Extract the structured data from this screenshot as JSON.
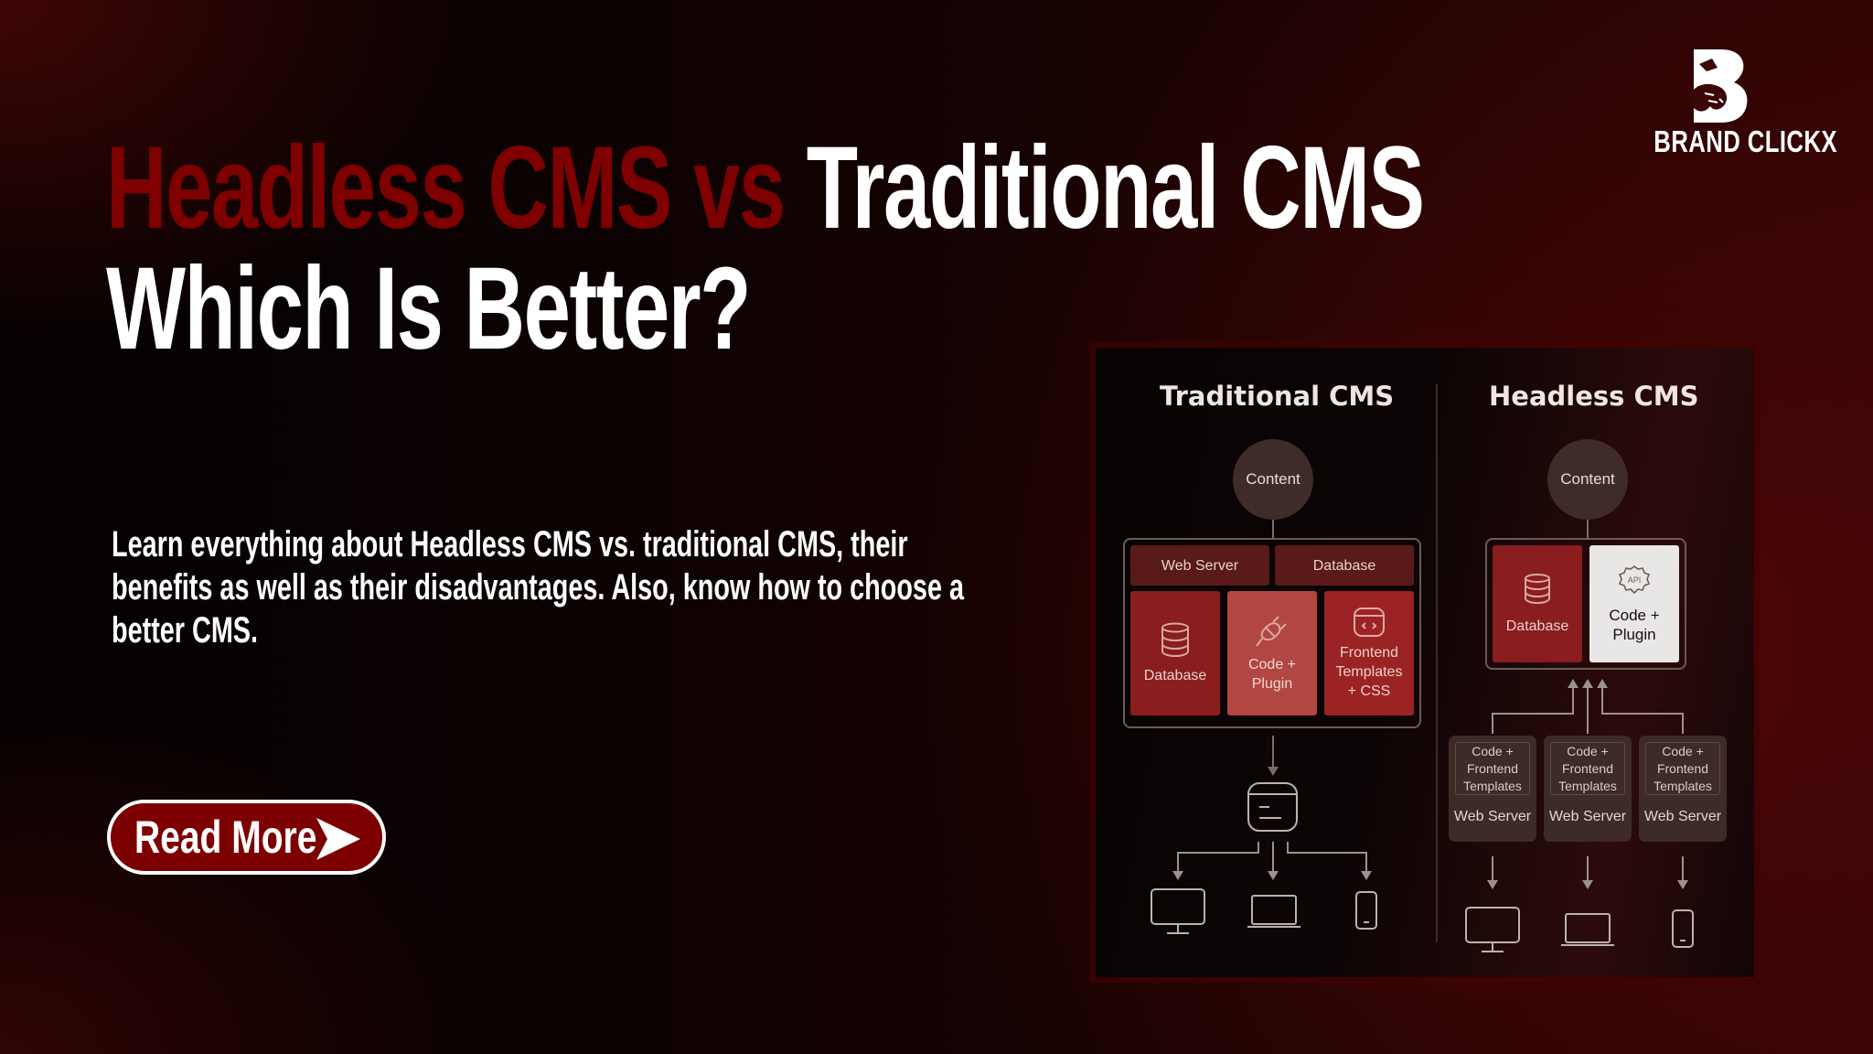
{
  "brand": {
    "name": "BRAND CLICKX",
    "logo_icon": "panther-b-logo-icon"
  },
  "headline": {
    "line1_highlight": "Headless CMS vs",
    "line1_rest": "Traditional CMS",
    "line2": "Which Is Better?",
    "highlight_color": "#7f0000"
  },
  "description": "Learn everything about Headless CMS vs. traditional CMS, their benefits as well as their disadvantages. Also, know how to choose a better CMS.",
  "cta": {
    "label": "Read More",
    "icon": "play-arrow-icon",
    "color": "#7d0000"
  },
  "diagram": {
    "traditional": {
      "title": "Traditional CMS",
      "content_label": "Content",
      "top_tiles": [
        "Web Server",
        "Database"
      ],
      "tiles": [
        {
          "label": "Database",
          "icon": "database-icon"
        },
        {
          "label": "Code + Plugin",
          "icon": "plug-icon"
        },
        {
          "label": "Frontend Templates + CSS",
          "icon": "code-window-icon"
        }
      ],
      "output_icon": "browser-window-icon",
      "devices": [
        "desktop-icon",
        "laptop-icon",
        "mobile-icon"
      ]
    },
    "headless": {
      "title": "Headless CMS",
      "content_label": "Content",
      "tiles": [
        {
          "label": "Database",
          "icon": "database-icon"
        },
        {
          "label": "Code + Plugin",
          "icon": "api-gear-icon",
          "icon_text": "API"
        }
      ],
      "servers": [
        {
          "inner": "Code + Frontend Templates",
          "label": "Web Server"
        },
        {
          "inner": "Code + Frontend Templates",
          "label": "Web Server"
        },
        {
          "inner": "Code + Frontend Templates",
          "label": "Web Server"
        }
      ],
      "devices": [
        "desktop-icon",
        "laptop-icon",
        "mobile-icon"
      ]
    }
  }
}
